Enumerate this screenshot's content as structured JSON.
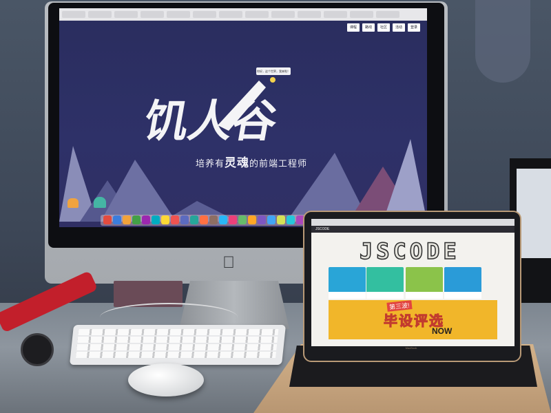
{
  "scene": {
    "colors": {
      "wall": "#4a5666",
      "desk": "#8e969f",
      "imac_screen_bg": "#2a2d5e",
      "laptop_frame": "#b99a77",
      "banner": "#f1b62a",
      "watch_strap": "#c21f2b"
    }
  },
  "imac": {
    "site": {
      "nav": [
        "课程",
        "路线",
        "社区",
        "活动",
        "登录"
      ],
      "speech_bubble": "你好，这个世界，我来啦！",
      "logo_text": "饥人谷",
      "slogan_prefix": "培养有",
      "slogan_highlight": "灵魂",
      "slogan_suffix": "的前端工程师"
    },
    "dock_icon_colors": [
      "#e34b3f",
      "#3b7ddd",
      "#f2a33a",
      "#43a047",
      "#9c27b0",
      "#00acc1",
      "#fdd835",
      "#ef5350",
      "#5c6bc0",
      "#26a69a",
      "#ff7043",
      "#8d6e63",
      "#29b6f6",
      "#ec407a",
      "#66bb6a",
      "#ffa726",
      "#7e57c2",
      "#42a5f5",
      "#d4e157",
      "#26c6da",
      "#ab47bc",
      "#ff8a65",
      "#78909c",
      "#ffca28",
      "#ef5350",
      "#5c6bc0",
      "#9ccc65",
      "#f06292"
    ]
  },
  "laptop": {
    "brand": "JSCODE",
    "hero": "JSCODE",
    "brand_label": "MacBook",
    "cards": [
      {
        "color": "#29a5d7"
      },
      {
        "color": "#33bfa0"
      },
      {
        "color": "#8bc34a"
      },
      {
        "color": "#2a9bd8"
      }
    ],
    "banner": {
      "sub": "第三波!",
      "main": "毕设评选",
      "now": "NOW"
    }
  }
}
